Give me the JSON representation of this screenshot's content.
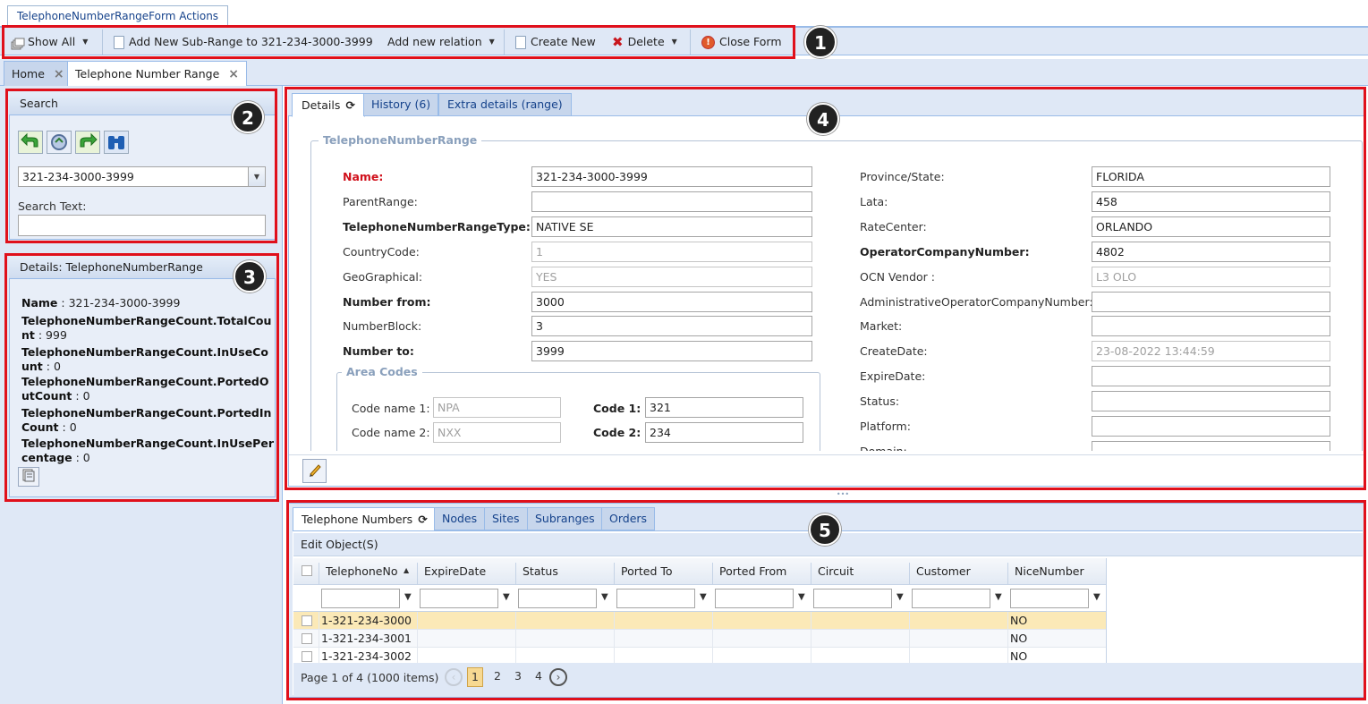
{
  "window": {
    "actions_tab": "TelephoneNumberRangeForm Actions"
  },
  "toolbar": {
    "show_all": "Show All",
    "add_sub_range": "Add New Sub-Range to 321-234-3000-3999",
    "add_relation": "Add new relation",
    "create_new": "Create New",
    "delete": "Delete",
    "close_form": "Close Form"
  },
  "doc_tabs": {
    "home": "Home",
    "current": "Telephone Number Range"
  },
  "badges": [
    "1",
    "2",
    "3",
    "4",
    "5"
  ],
  "search": {
    "title": "Search",
    "combo_value": "321-234-3000-3999",
    "text_label": "Search Text:",
    "text_value": ""
  },
  "details_panel": {
    "title": "Details: TelephoneNumberRange",
    "rows": [
      {
        "key": "Name",
        "value": "321-234-3000-3999"
      },
      {
        "key": "TelephoneNumberRangeCount.TotalCount",
        "value": "999"
      },
      {
        "key": "TelephoneNumberRangeCount.InUseCount",
        "value": "0"
      },
      {
        "key": "TelephoneNumberRangeCount.PortedOutCount",
        "value": "0"
      },
      {
        "key": "TelephoneNumberRangeCount.PortedInCount",
        "value": "0"
      },
      {
        "key": "TelephoneNumberRangeCount.InUsePercentage",
        "value": "0"
      }
    ]
  },
  "form_tabs": {
    "details": "Details",
    "history": "History (6)",
    "extra": "Extra details (range)"
  },
  "form": {
    "fieldset": "TelephoneNumberRange",
    "left_fields": [
      {
        "label": "Name:",
        "value": "321-234-3000-3999",
        "style": "red",
        "disabled": false
      },
      {
        "label": "ParentRange:",
        "value": "",
        "style": "normal",
        "disabled": false
      },
      {
        "label": "TelephoneNumberRangeType:",
        "value": "NATIVE SE",
        "style": "bold",
        "disabled": false
      },
      {
        "label": "CountryCode:",
        "value": "1",
        "style": "normal",
        "disabled": true
      },
      {
        "label": "GeoGraphical:",
        "value": "YES",
        "style": "normal",
        "disabled": true
      },
      {
        "label": "Number from:",
        "value": "3000",
        "style": "bold",
        "disabled": false
      },
      {
        "label": "NumberBlock:",
        "value": "3",
        "style": "normal",
        "disabled": false
      },
      {
        "label": "Number to:",
        "value": "3999",
        "style": "bold",
        "disabled": false
      }
    ],
    "right_fields": [
      {
        "label": "Province/State:",
        "value": "FLORIDA",
        "style": "normal",
        "disabled": false
      },
      {
        "label": "Lata:",
        "value": "458",
        "style": "normal",
        "disabled": false
      },
      {
        "label": "RateCenter:",
        "value": "ORLANDO",
        "style": "normal",
        "disabled": false
      },
      {
        "label": "OperatorCompanyNumber:",
        "value": "4802",
        "style": "bold",
        "disabled": false
      },
      {
        "label": "OCN Vendor :",
        "value": "L3 OLO",
        "style": "normal",
        "disabled": true
      },
      {
        "label": "AdministrativeOperatorCompanyNumber:",
        "value": "",
        "style": "normal",
        "disabled": false
      },
      {
        "label": "Market:",
        "value": "",
        "style": "normal",
        "disabled": false
      },
      {
        "label": "CreateDate:",
        "value": "23-08-2022 13:44:59",
        "style": "normal",
        "disabled": true
      },
      {
        "label": "ExpireDate:",
        "value": "",
        "style": "normal",
        "disabled": false
      },
      {
        "label": "Status:",
        "value": "",
        "style": "normal",
        "disabled": false
      },
      {
        "label": "Platform:",
        "value": "",
        "style": "normal",
        "disabled": false
      },
      {
        "label": "Domain:",
        "value": "",
        "style": "normal",
        "disabled": false
      }
    ],
    "area_codes": {
      "legend": "Area Codes",
      "code_name_1_label": "Code name 1:",
      "code_name_1_value": "NPA",
      "code_name_2_label": "Code name 2:",
      "code_name_2_value": "NXX",
      "code_1_label": "Code 1:",
      "code_1_value": "321",
      "code_2_label": "Code 2:",
      "code_2_value": "234"
    }
  },
  "bottom_tabs": {
    "telephone_numbers": "Telephone Numbers",
    "nodes": "Nodes",
    "sites": "Sites",
    "subranges": "Subranges",
    "orders": "Orders"
  },
  "grid": {
    "edit_objects": "Edit Object(S)",
    "columns": [
      "TelephoneNo",
      "ExpireDate",
      "Status",
      "Ported To",
      "Ported From",
      "Circuit",
      "Customer",
      "NiceNumber"
    ],
    "rows": [
      {
        "tel": "1-321-234-3000",
        "nice": "NO",
        "selected": true
      },
      {
        "tel": "1-321-234-3001",
        "nice": "NO",
        "selected": false
      },
      {
        "tel": "1-321-234-3002",
        "nice": "NO",
        "selected": false
      }
    ],
    "pager_text": "Page 1 of 4 (1000 items)",
    "pages": [
      "1",
      "2",
      "3",
      "4"
    ],
    "current_page": "1"
  },
  "colors": {
    "accent_red": "#e0101b",
    "header_blue": "#dfe8f6",
    "selected_row": "#fbe9b7"
  }
}
